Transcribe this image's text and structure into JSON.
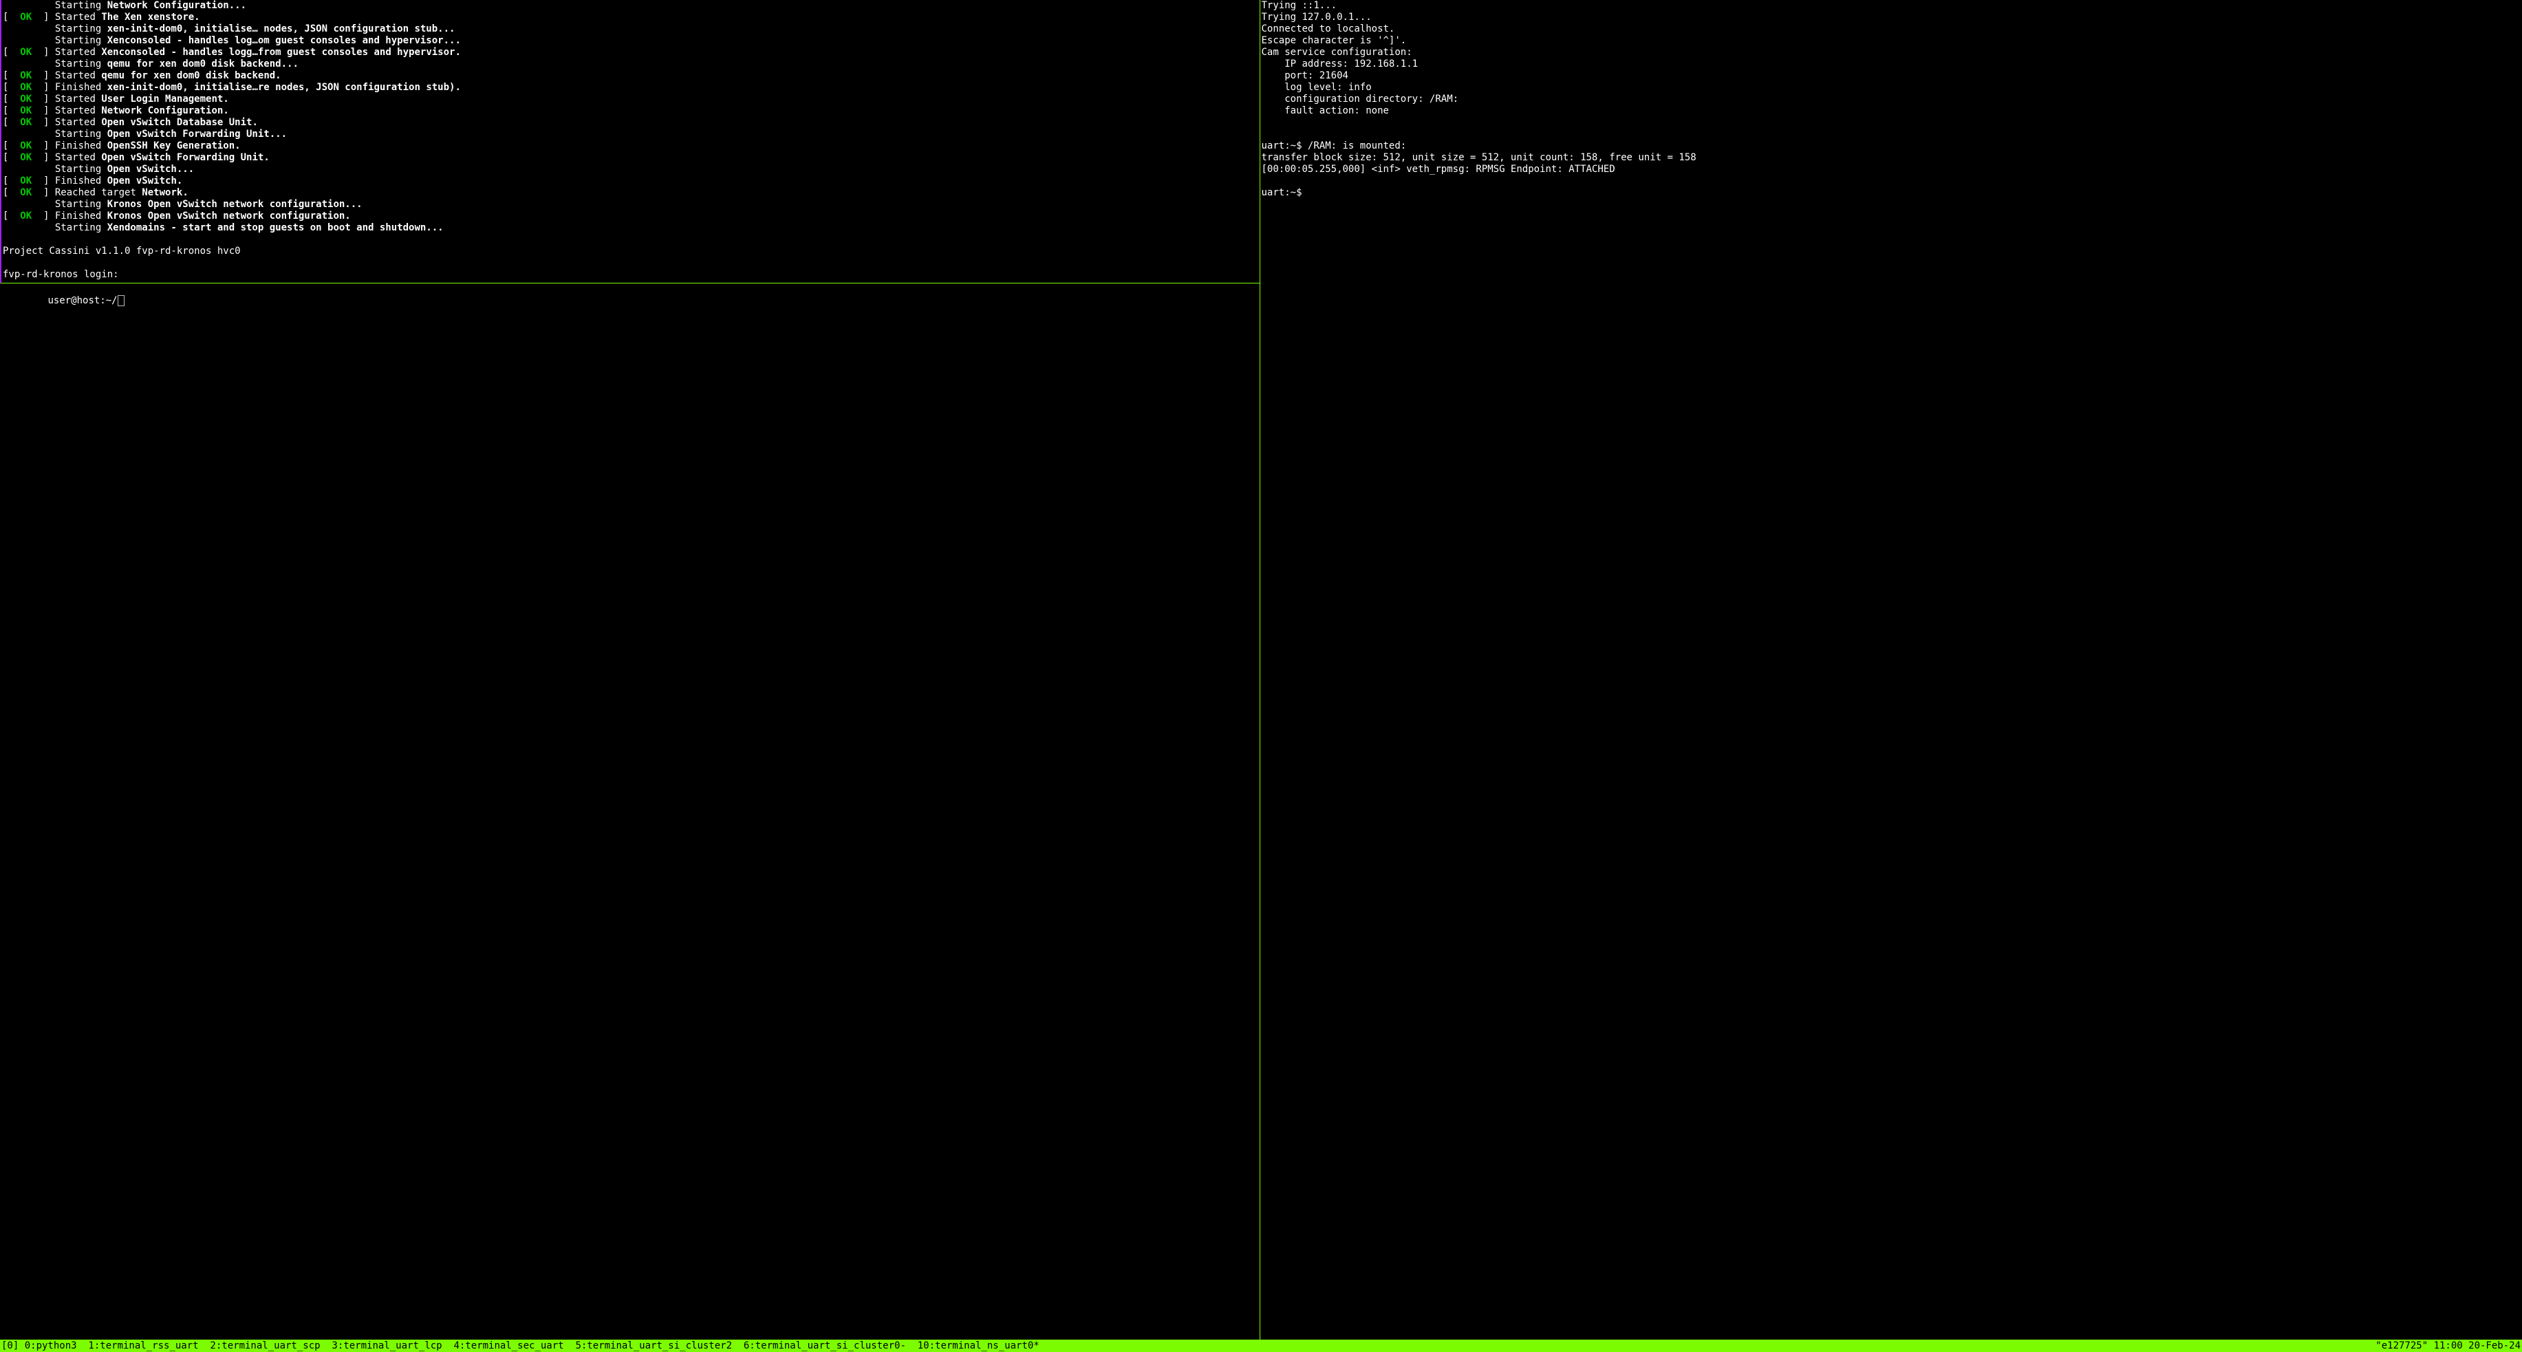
{
  "top_pane": {
    "lines": [
      {
        "type": "starting",
        "indent": "         ",
        "word": "Starting",
        "rest": "Network Configuration..."
      },
      {
        "type": "ok",
        "word": "Started",
        "rest": "The Xen xenstore."
      },
      {
        "type": "starting",
        "indent": "         ",
        "word": "Starting",
        "rest": "xen-init-dom0, initialise… nodes, JSON configuration stub..."
      },
      {
        "type": "starting",
        "indent": "         ",
        "word": "Starting",
        "rest": "Xenconsoled - handles log…om guest consoles and hypervisor..."
      },
      {
        "type": "ok",
        "word": "Started",
        "rest": "Xenconsoled - handles logg…from guest consoles and hypervisor."
      },
      {
        "type": "starting",
        "indent": "         ",
        "word": "Starting",
        "rest": "qemu for xen dom0 disk backend..."
      },
      {
        "type": "ok",
        "word": "Started",
        "rest": "qemu for xen dom0 disk backend."
      },
      {
        "type": "ok",
        "word": "Finished",
        "rest": "xen-init-dom0, initialise…re nodes, JSON configuration stub)."
      },
      {
        "type": "ok",
        "word": "Started",
        "rest": "User Login Management."
      },
      {
        "type": "ok",
        "word": "Started",
        "rest": "Network Configuration."
      },
      {
        "type": "ok",
        "word": "Started",
        "rest": "Open vSwitch Database Unit."
      },
      {
        "type": "starting",
        "indent": "         ",
        "word": "Starting",
        "rest": "Open vSwitch Forwarding Unit..."
      },
      {
        "type": "ok",
        "word": "Finished",
        "rest": "OpenSSH Key Generation."
      },
      {
        "type": "ok",
        "word": "Started",
        "rest": "Open vSwitch Forwarding Unit."
      },
      {
        "type": "starting",
        "indent": "         ",
        "word": "Starting",
        "rest": "Open vSwitch..."
      },
      {
        "type": "ok",
        "word": "Finished",
        "rest": "Open vSwitch."
      },
      {
        "type": "ok",
        "word": "Reached target",
        "rest": "Network."
      },
      {
        "type": "starting",
        "indent": "         ",
        "word": "Starting",
        "rest": "Kronos Open vSwitch network configuration..."
      },
      {
        "type": "ok",
        "word": "Finished",
        "rest": "Kronos Open vSwitch network configuration."
      },
      {
        "type": "starting",
        "indent": "         ",
        "word": "Starting",
        "rest": "Xendomains - start and stop guests on boot and shutdown..."
      },
      {
        "type": "blank"
      },
      {
        "type": "plain",
        "text": "Project Cassini v1.1.0 fvp-rd-kronos hvc0"
      },
      {
        "type": "blank"
      },
      {
        "type": "plain",
        "text": "fvp-rd-kronos login:"
      },
      {
        "type": "blank-short"
      }
    ]
  },
  "bottom_pane": {
    "prompt": "user@host:~/",
    "cursor": true
  },
  "right_pane": {
    "lines": [
      "Trying ::1...",
      "Trying 127.0.0.1...",
      "Connected to localhost.",
      "Escape character is '^]'.",
      "Cam service configuration:",
      "    IP address: 192.168.1.1",
      "    port: 21604",
      "    log level: info",
      "    configuration directory: /RAM:",
      "    fault action: none",
      "",
      "",
      "uart:~$ /RAM: is mounted:",
      "transfer block size: 512, unit size = 512, unit count: 158, free unit = 158",
      "[00:00:05.255,000] <inf> veth_rpmsg: RPMSG Endpoint: ATTACHED",
      "",
      "uart:~$ "
    ]
  },
  "statusbar": {
    "session": "[0]",
    "windows": [
      "0:python3",
      "1:terminal_rss_uart",
      "2:terminal_uart_scp",
      "3:terminal_uart_lcp",
      "4:terminal_sec_uart",
      "5:terminal_uart_si_cluster2",
      "6:terminal_uart_si_cluster0-",
      "10:terminal_ns_uart0*"
    ],
    "host": "\"e127725\"",
    "time": "11:00",
    "date": "20-Feb-24"
  }
}
